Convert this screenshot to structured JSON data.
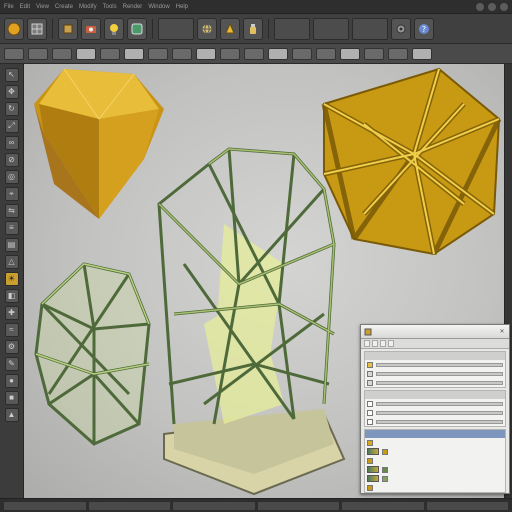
{
  "menubar": {
    "items": [
      "File",
      "Edit",
      "View",
      "Create",
      "Modify",
      "Tools",
      "Render",
      "Window",
      "Help"
    ]
  },
  "toolbar1": {
    "icons": [
      "orb-icon",
      "grid-icon",
      "box-icon",
      "camera-icon",
      "light-icon",
      "render-icon",
      "globe-icon",
      "material-icon",
      "bottle-icon"
    ],
    "wide_labels": [
      "",
      "",
      "",
      ""
    ]
  },
  "toolbar2": {
    "buttons": [
      "",
      "",
      "",
      "",
      "",
      "",
      "",
      "",
      "",
      "",
      "",
      "",
      "",
      "",
      "",
      "",
      "",
      "",
      "",
      ""
    ]
  },
  "leftbar": {
    "icons": [
      "select-icon",
      "move-icon",
      "rotate-icon",
      "scale-icon",
      "link-icon",
      "unlink-icon",
      "bind-icon",
      "snap-icon",
      "mirror-icon",
      "align-icon",
      "layer-icon",
      "shape-icon",
      "light-icon",
      "camera-icon",
      "helper-icon",
      "warp-icon",
      "system-icon",
      "paint-icon",
      "sphere-icon",
      "box-icon",
      "cone-icon"
    ]
  },
  "viewport": {
    "objects": [
      {
        "name": "gold-gem",
        "color": "#d9a820"
      },
      {
        "name": "gold-wire-icosahedron",
        "color": "#c99a12"
      },
      {
        "name": "green-wire-tower",
        "color": "#6a7f4a"
      },
      {
        "name": "green-wire-cage",
        "color": "#7d9a58"
      }
    ],
    "background": "#c4c4c2"
  },
  "panel": {
    "title": "",
    "tabs": [
      "",
      "",
      "",
      ""
    ],
    "sections": [
      {
        "rows": 3
      },
      {
        "rows": 3
      },
      {
        "rows": 6
      }
    ]
  },
  "colors": {
    "accent_gold": "#d4a21c",
    "accent_green": "#6e8a4c",
    "ui_dark": "#3a3a3a"
  }
}
